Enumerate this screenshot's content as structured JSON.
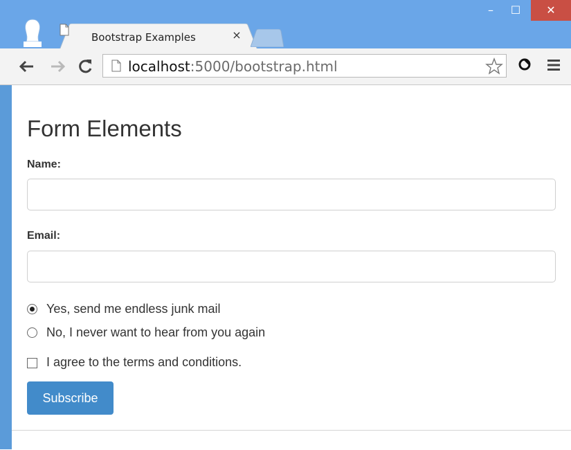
{
  "browser": {
    "tab_title": "Bootstrap Examples",
    "tab_close": "×",
    "url_host": "localhost",
    "url_rest": ":5000/bootstrap.html",
    "window_controls": {
      "minimize": "–",
      "maximize": "☐",
      "close": "✕"
    },
    "icons": [
      "profile-icon",
      "page-icon",
      "back-arrow-icon",
      "forward-arrow-icon",
      "reload-icon",
      "star-icon",
      "extension-icon",
      "menu-icon"
    ]
  },
  "page": {
    "heading": "Form Elements",
    "name_label": "Name:",
    "email_label": "Email:",
    "radio_options": [
      {
        "label": "Yes, send me endless junk mail",
        "checked": true
      },
      {
        "label": "No, I never want to hear from you again",
        "checked": false
      }
    ],
    "checkbox": {
      "label": "I agree to the terms and conditions.",
      "checked": false
    },
    "subscribe_label": "Subscribe"
  },
  "colors": {
    "titlebar": "#6aa6e8",
    "close_button": "#c94f44",
    "primary_button": "#428bca"
  }
}
